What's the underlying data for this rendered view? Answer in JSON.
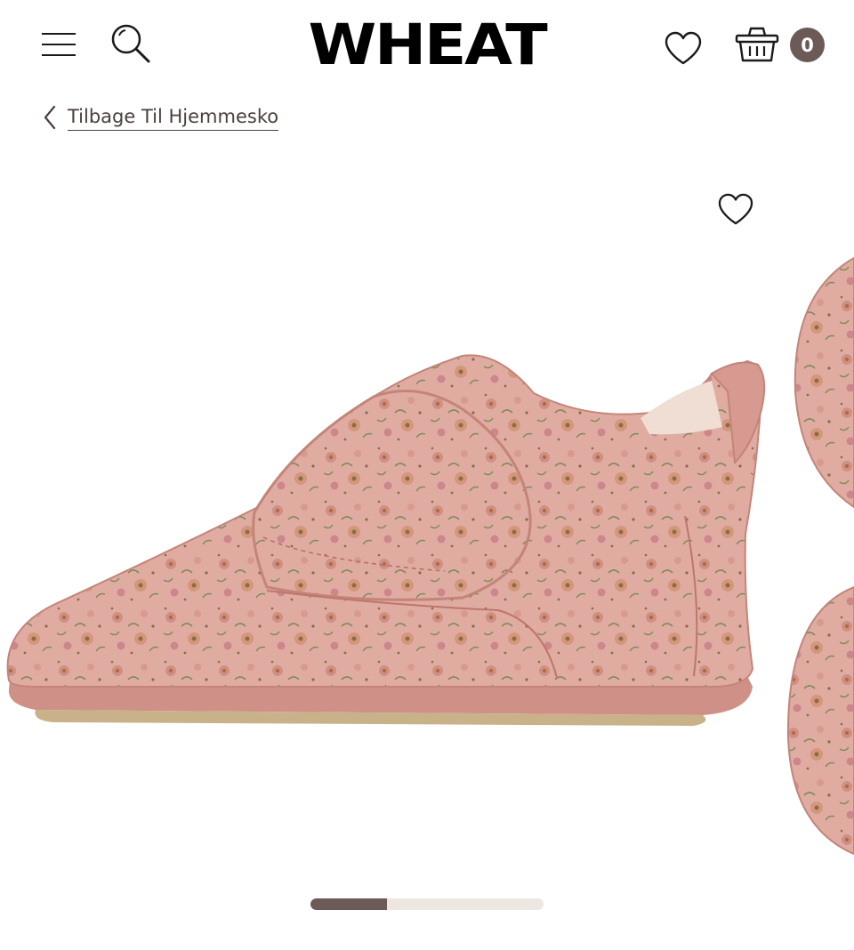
{
  "header": {
    "logo_text": "WHEAT",
    "cart_count": "0",
    "icons": {
      "menu": "menu-icon",
      "search": "search-icon",
      "wishlist": "heart-icon",
      "cart": "basket-icon"
    }
  },
  "breadcrumb": {
    "back_label": "Tilbage Til Hjemmesko"
  },
  "gallery": {
    "progress_fraction": 0.33
  },
  "colors": {
    "accent": "#6b5a56",
    "track": "#ede6e1",
    "shoe_pink": "#dba39a",
    "sole": "#c98f86"
  }
}
